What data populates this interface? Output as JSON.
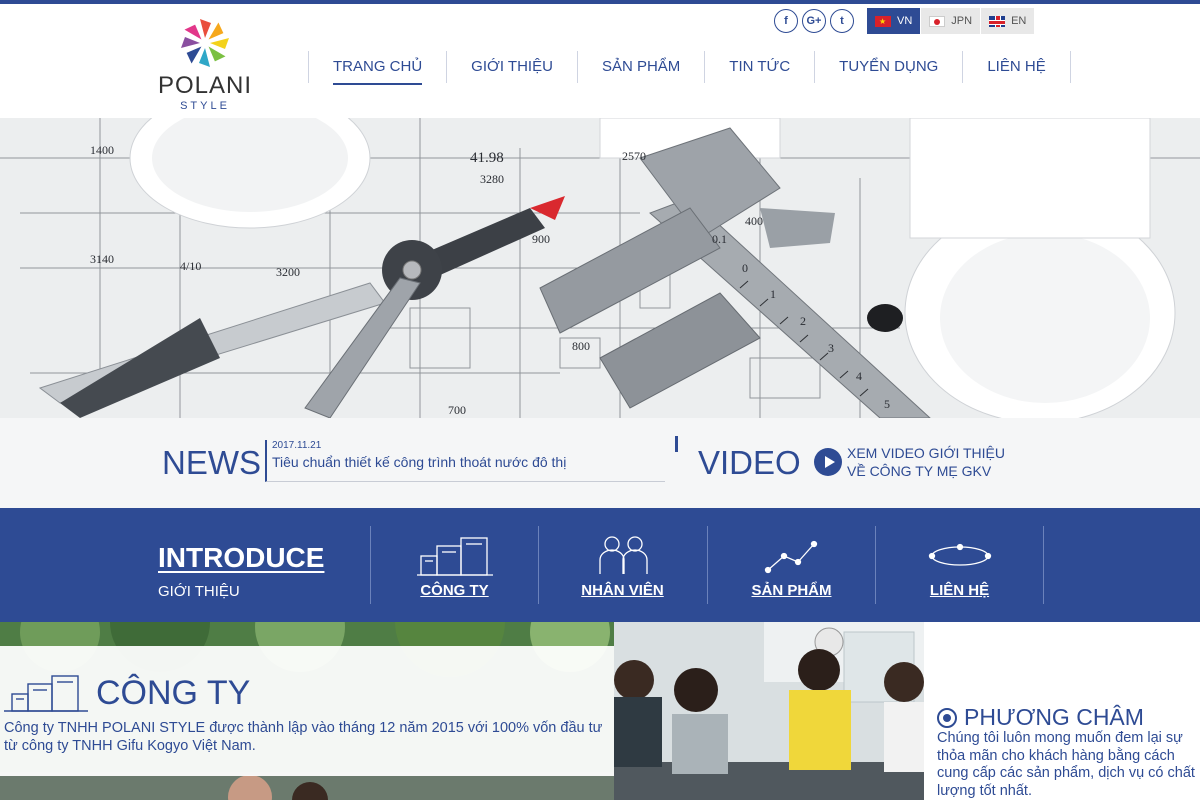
{
  "brand": {
    "name": "POLANI",
    "tagline": "STYLE",
    "colors": {
      "primary": "#2e4b94",
      "white": "#ffffff"
    }
  },
  "social": [
    {
      "icon": "facebook-icon",
      "glyph": "f"
    },
    {
      "icon": "google-plus-icon",
      "glyph": "G+"
    },
    {
      "icon": "twitter-icon",
      "glyph": "t"
    }
  ],
  "languages": [
    {
      "code": "VN",
      "label": "VN",
      "active": true
    },
    {
      "code": "JPN",
      "label": "JPN",
      "active": false
    },
    {
      "code": "EN",
      "label": "EN",
      "active": false
    }
  ],
  "nav": [
    {
      "label": "TRANG CHỦ",
      "active": true
    },
    {
      "label": "GIỚI THIỆU",
      "active": false
    },
    {
      "label": "SẢN PHẨM",
      "active": false
    },
    {
      "label": "TIN TỨC",
      "active": false
    },
    {
      "label": "TUYỂN DỤNG",
      "active": false
    },
    {
      "label": "LIÊN HỆ",
      "active": false
    }
  ],
  "news": {
    "title": "NEWS",
    "date": "2017.11.21",
    "headline": "Tiêu chuẩn thiết kế công trình thoát nước đô thị"
  },
  "video": {
    "title": "VIDEO",
    "line1": "XEM VIDEO GIỚI THIỆU",
    "line2": "VỀ CÔNG TY MẸ GKV"
  },
  "introduce": {
    "title": "INTRODUCE",
    "subtitle": "GIỚI THIỆU",
    "items": [
      {
        "label": "CÔNG TY",
        "icon": "building-icon"
      },
      {
        "label": "NHÂN VIÊN",
        "icon": "people-icon"
      },
      {
        "label": "SẢN PHẨM",
        "icon": "line-chart-icon"
      },
      {
        "label": "LIÊN HỆ",
        "icon": "orbit-icon"
      }
    ]
  },
  "company": {
    "title": "CÔNG TY",
    "text": "Công ty TNHH POLANI STYLE được thành lập vào tháng 12 năm 2015 với 100% vốn đầu tư từ công ty TNHH Gifu Kogyo Việt Nam."
  },
  "motto": {
    "title": "PHƯƠNG CHÂM",
    "lines": [
      "Chúng tôi luôn mong muốn đem lại sự",
      "thỏa mãn cho khách hàng bằng cách",
      "cung cấp các sản phẩm, dịch vụ có chất",
      "lượng tốt nhất."
    ]
  },
  "hero_labels": [
    "41.98",
    "3280",
    "2570",
    "3140",
    "3200",
    "4/10",
    "900",
    "800",
    "700",
    "400",
    "1400",
    "0.1",
    "0",
    "1",
    "2",
    "3",
    "4",
    "5"
  ]
}
